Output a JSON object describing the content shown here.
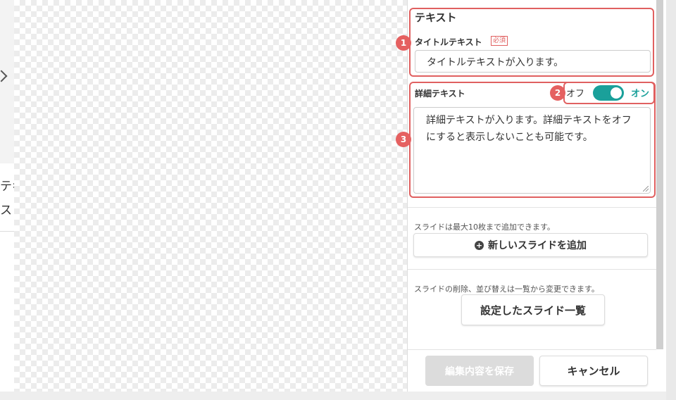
{
  "left_peek": {
    "line1": "テキ",
    "line2": "ス"
  },
  "panel": {
    "section_title": "テキスト",
    "title_field": {
      "label": "タイトルテキスト",
      "required_badge": "必須",
      "value": "タイトルテキストが入ります。"
    },
    "detail_field": {
      "label": "詳細テキスト",
      "toggle_off": "オフ",
      "toggle_on": "オン",
      "toggle_state": "on",
      "value": "詳細テキストが入ります。詳細テキストをオフにすると表示しないことも可能です。"
    },
    "add_note": "スライドは最大10枚まで追加できます。",
    "add_button_label": "新しいスライドを追加",
    "list_note": "スライドの削除、並び替えは一覧から変更できます。",
    "list_button_label": "設定したスライド一覧",
    "save_button_label": "編集内容を保存",
    "cancel_button_label": "キャンセル"
  },
  "annotations": [
    "1",
    "2",
    "3"
  ],
  "colors": {
    "accent": "#1aa09a",
    "highlight": "#e06060",
    "disabled": "#dcdcdc"
  }
}
